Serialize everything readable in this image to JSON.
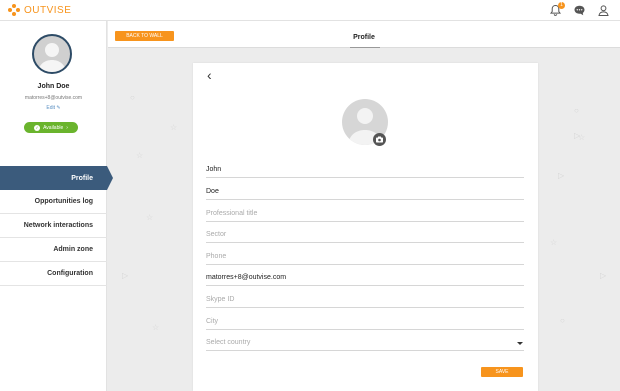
{
  "app": {
    "logo_text": "OUTVISE"
  },
  "topbar": {
    "notification_count": "1",
    "icons": [
      "bell-icon",
      "chat-icon",
      "user-icon"
    ]
  },
  "sidebar": {
    "user_name": "John Doe",
    "user_email": "matorres+8@outvise.com",
    "edit_label": "Edit",
    "status_label": "Available",
    "menu": [
      {
        "label": "Profile",
        "active": true
      },
      {
        "label": "Opportunities log",
        "active": false
      },
      {
        "label": "Network interactions",
        "active": false
      },
      {
        "label": "Admin zone",
        "active": false
      },
      {
        "label": "Configuration",
        "active": false
      }
    ]
  },
  "main": {
    "back_button": "BACK TO WALL",
    "title": "Profile",
    "form": {
      "first_name": "John",
      "last_name": "Doe",
      "professional_title_placeholder": "Professional title",
      "sector_placeholder": "Sector",
      "phone_placeholder": "Phone",
      "email": "matorres+8@outvise.com",
      "skype_placeholder": "Skype ID",
      "city_placeholder": "City",
      "country_placeholder": "Select country",
      "save_label": "SAVE"
    }
  },
  "colors": {
    "accent": "#f7941d",
    "nav_active": "#3b5b7c",
    "available": "#6ab42d"
  }
}
